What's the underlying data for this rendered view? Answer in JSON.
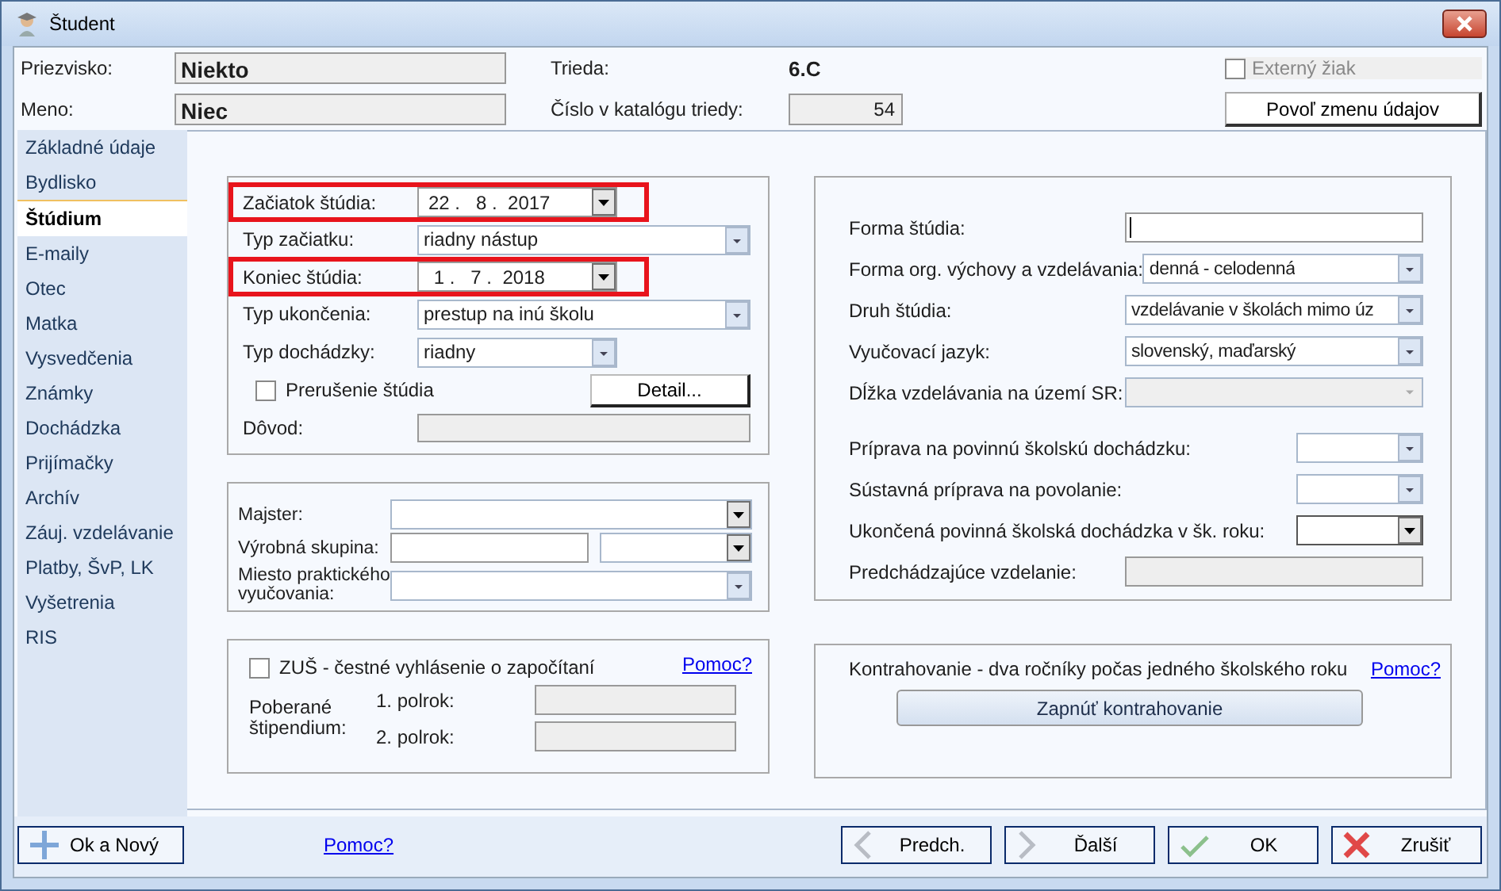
{
  "window": {
    "title": "Študent"
  },
  "header": {
    "surname": {
      "label": "Priezvisko:",
      "value": "Niekto"
    },
    "name": {
      "label": "Meno:",
      "value": "Niec"
    },
    "class": {
      "label": "Trieda:",
      "value": "6.C"
    },
    "catalog": {
      "label": "Číslo v katalógu triedy:",
      "value": "54"
    },
    "external": {
      "label": "Externý žiak",
      "checked": false,
      "disabled": true
    },
    "allow_button": "Povoľ zmenu údajov"
  },
  "sidebar": {
    "items": [
      {
        "label": "Základné údaje",
        "selected": false
      },
      {
        "label": "Bydlisko",
        "selected": false
      },
      {
        "label": "Štúdium",
        "selected": true
      },
      {
        "label": "E-maily",
        "selected": false
      },
      {
        "label": "Otec",
        "selected": false
      },
      {
        "label": "Matka",
        "selected": false
      },
      {
        "label": "Vysvedčenia",
        "selected": false
      },
      {
        "label": "Známky",
        "selected": false
      },
      {
        "label": "Dochádzka",
        "selected": false
      },
      {
        "label": "Prijímačky",
        "selected": false
      },
      {
        "label": "Archív",
        "selected": false
      },
      {
        "label": "Záuj. vzdelávanie",
        "selected": false
      },
      {
        "label": "Platby, ŠvP, LK",
        "selected": false
      },
      {
        "label": "Vyšetrenia",
        "selected": false
      },
      {
        "label": "RIS",
        "selected": false
      }
    ]
  },
  "study": {
    "rows": [
      {
        "kind": "date",
        "label": "Začiatok štúdia:",
        "value": "22 .   8 .  2017",
        "highlighted": true
      },
      {
        "kind": "combo",
        "label": "Typ začiatku:",
        "value": "riadny nástup",
        "highlighted": false
      },
      {
        "kind": "date",
        "label": "Koniec štúdia:",
        "value": " 1 .   7 .  2018",
        "highlighted": true
      },
      {
        "kind": "combo",
        "label": "Typ ukončenia:",
        "value": "prestup na inú školu",
        "highlighted": false
      },
      {
        "kind": "combo_short",
        "label": "Typ dochádzky:",
        "value": "riadny",
        "highlighted": false
      },
      {
        "kind": "checkbox_button",
        "label": "Prerušenie štúdia",
        "checked": false,
        "button": "Detail...",
        "highlighted": false
      },
      {
        "kind": "disabled_field",
        "label": "Dôvod:",
        "highlighted": false
      }
    ]
  },
  "practice": {
    "rows": [
      {
        "kind": "combo_dark",
        "label": "Majster:"
      },
      {
        "kind": "field_combo",
        "label": "Výrobná skupina:"
      },
      {
        "kind": "combo",
        "label": "Miesto praktického vyučovania:"
      }
    ]
  },
  "zus": {
    "checkbox": {
      "label": "ZUŠ - čestné vyhlásenie o započítaní",
      "checked": false
    },
    "help_link": "Pomoc?",
    "stipend_label": "Poberané štipendium:",
    "terms": [
      "1. polrok:",
      "2. polrok:"
    ]
  },
  "form": {
    "rows": [
      {
        "kind": "text_input",
        "label": "Forma štúdia:"
      },
      {
        "kind": "combo",
        "label": "Forma org. výchovy a vzdelávania:",
        "value": "denná - celodenná"
      },
      {
        "kind": "combo",
        "label": "Druh štúdia:",
        "value": "vzdelávanie  v školách mimo úz"
      },
      {
        "kind": "combo",
        "label": "Vyučovací jazyk:",
        "value": "slovenský, maďarský"
      },
      {
        "kind": "combo_disabled",
        "label": "Dĺžka vzdelávania na území SR:"
      },
      {
        "kind": "spacer"
      },
      {
        "kind": "combo_small",
        "label": "Príprava na povinnú školskú dochádzku:"
      },
      {
        "kind": "combo_small",
        "label": "Sústavná príprava na povolanie:"
      },
      {
        "kind": "combo_small_dark",
        "label": "Ukončená povinná školská dochádzka v šk. roku:"
      },
      {
        "kind": "disabled_field",
        "label": "Predchádzajúce vzdelanie:"
      }
    ]
  },
  "contract": {
    "text": "Kontrahovanie - dva ročníky počas jedného školského roku",
    "help_link": "Pomoc?",
    "button": "Zapnúť kontrahovanie"
  },
  "footer": {
    "ok_new": "Ok a Nový",
    "help_link": "Pomoc?",
    "buttons": [
      {
        "kind": "prev",
        "label": "Predch."
      },
      {
        "kind": "next",
        "label": "Ďalší"
      },
      {
        "kind": "ok",
        "label": "OK"
      },
      {
        "kind": "cancel",
        "label": "Zrušiť"
      }
    ]
  }
}
